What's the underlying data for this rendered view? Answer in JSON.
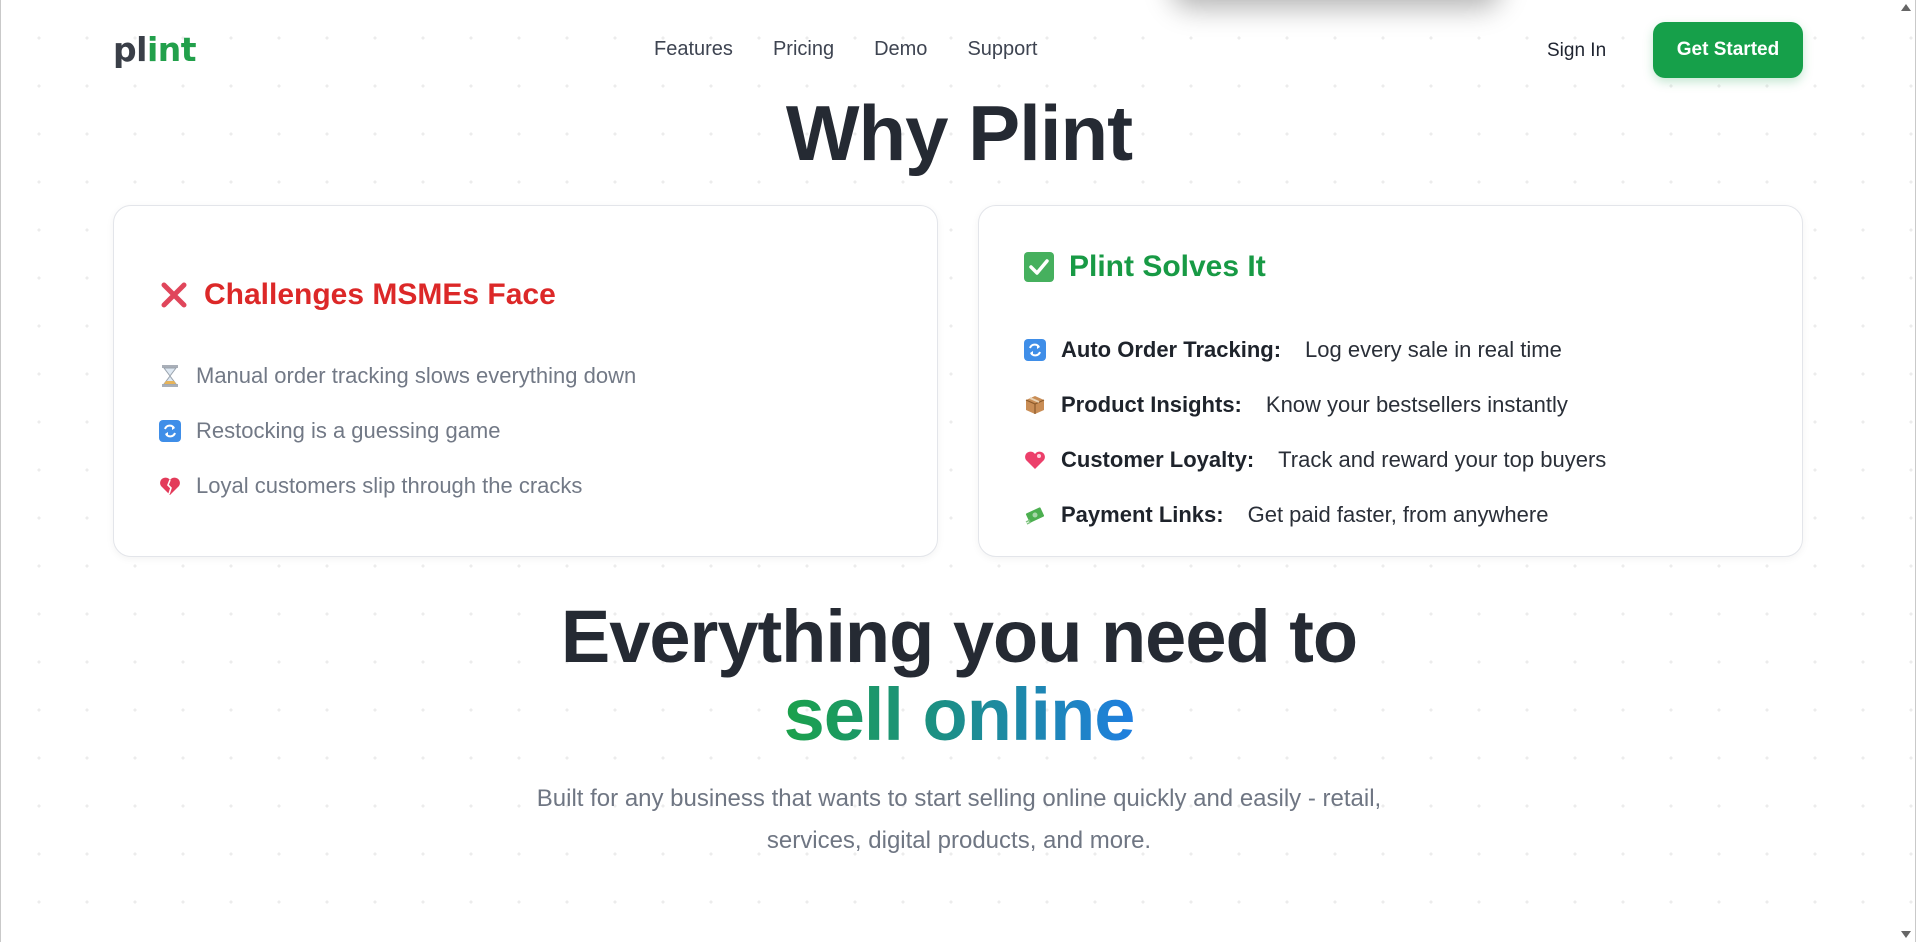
{
  "brand": {
    "logo_prefix": "pl",
    "logo_accent": "int"
  },
  "nav": [
    {
      "label": "Features"
    },
    {
      "label": "Pricing"
    },
    {
      "label": "Demo"
    },
    {
      "label": "Support"
    }
  ],
  "header": {
    "sign_in": "Sign In",
    "get_started": "Get Started"
  },
  "why": {
    "heading": "Why Plint"
  },
  "challenges": {
    "title": "Challenges MSMEs Face",
    "icon": "cross-mark-icon",
    "items": [
      {
        "icon": "hourglass-icon",
        "text": "Manual order tracking slows everything down"
      },
      {
        "icon": "refresh-icon",
        "text": "Restocking is a guessing game"
      },
      {
        "icon": "broken-heart-icon",
        "text": "Loyal customers slip through the cracks"
      }
    ]
  },
  "solutions": {
    "title": "Plint Solves It",
    "icon": "check-mark-icon",
    "items": [
      {
        "icon": "refresh-icon",
        "label": "Auto Order Tracking:",
        "text": "Log every sale in real time"
      },
      {
        "icon": "package-icon",
        "label": "Product Insights:",
        "text": "Know your bestsellers instantly"
      },
      {
        "icon": "heart-icon",
        "label": "Customer Loyalty:",
        "text": "Track and reward your top buyers"
      },
      {
        "icon": "money-icon",
        "label": "Payment Links:",
        "text": "Get paid faster, from anywhere"
      }
    ]
  },
  "hero2": {
    "line1": "Everything you need to",
    "line2": "sell online",
    "subtitle_line1": "Built for any business that wants to start selling online quickly and easily - retail,",
    "subtitle_line2": "services, digital products, and more."
  },
  "colors": {
    "brand_green": "#16a04a",
    "challenge_red": "#dc2828",
    "solve_green": "#189a45",
    "gradient_blue": "#1f7fe0"
  }
}
